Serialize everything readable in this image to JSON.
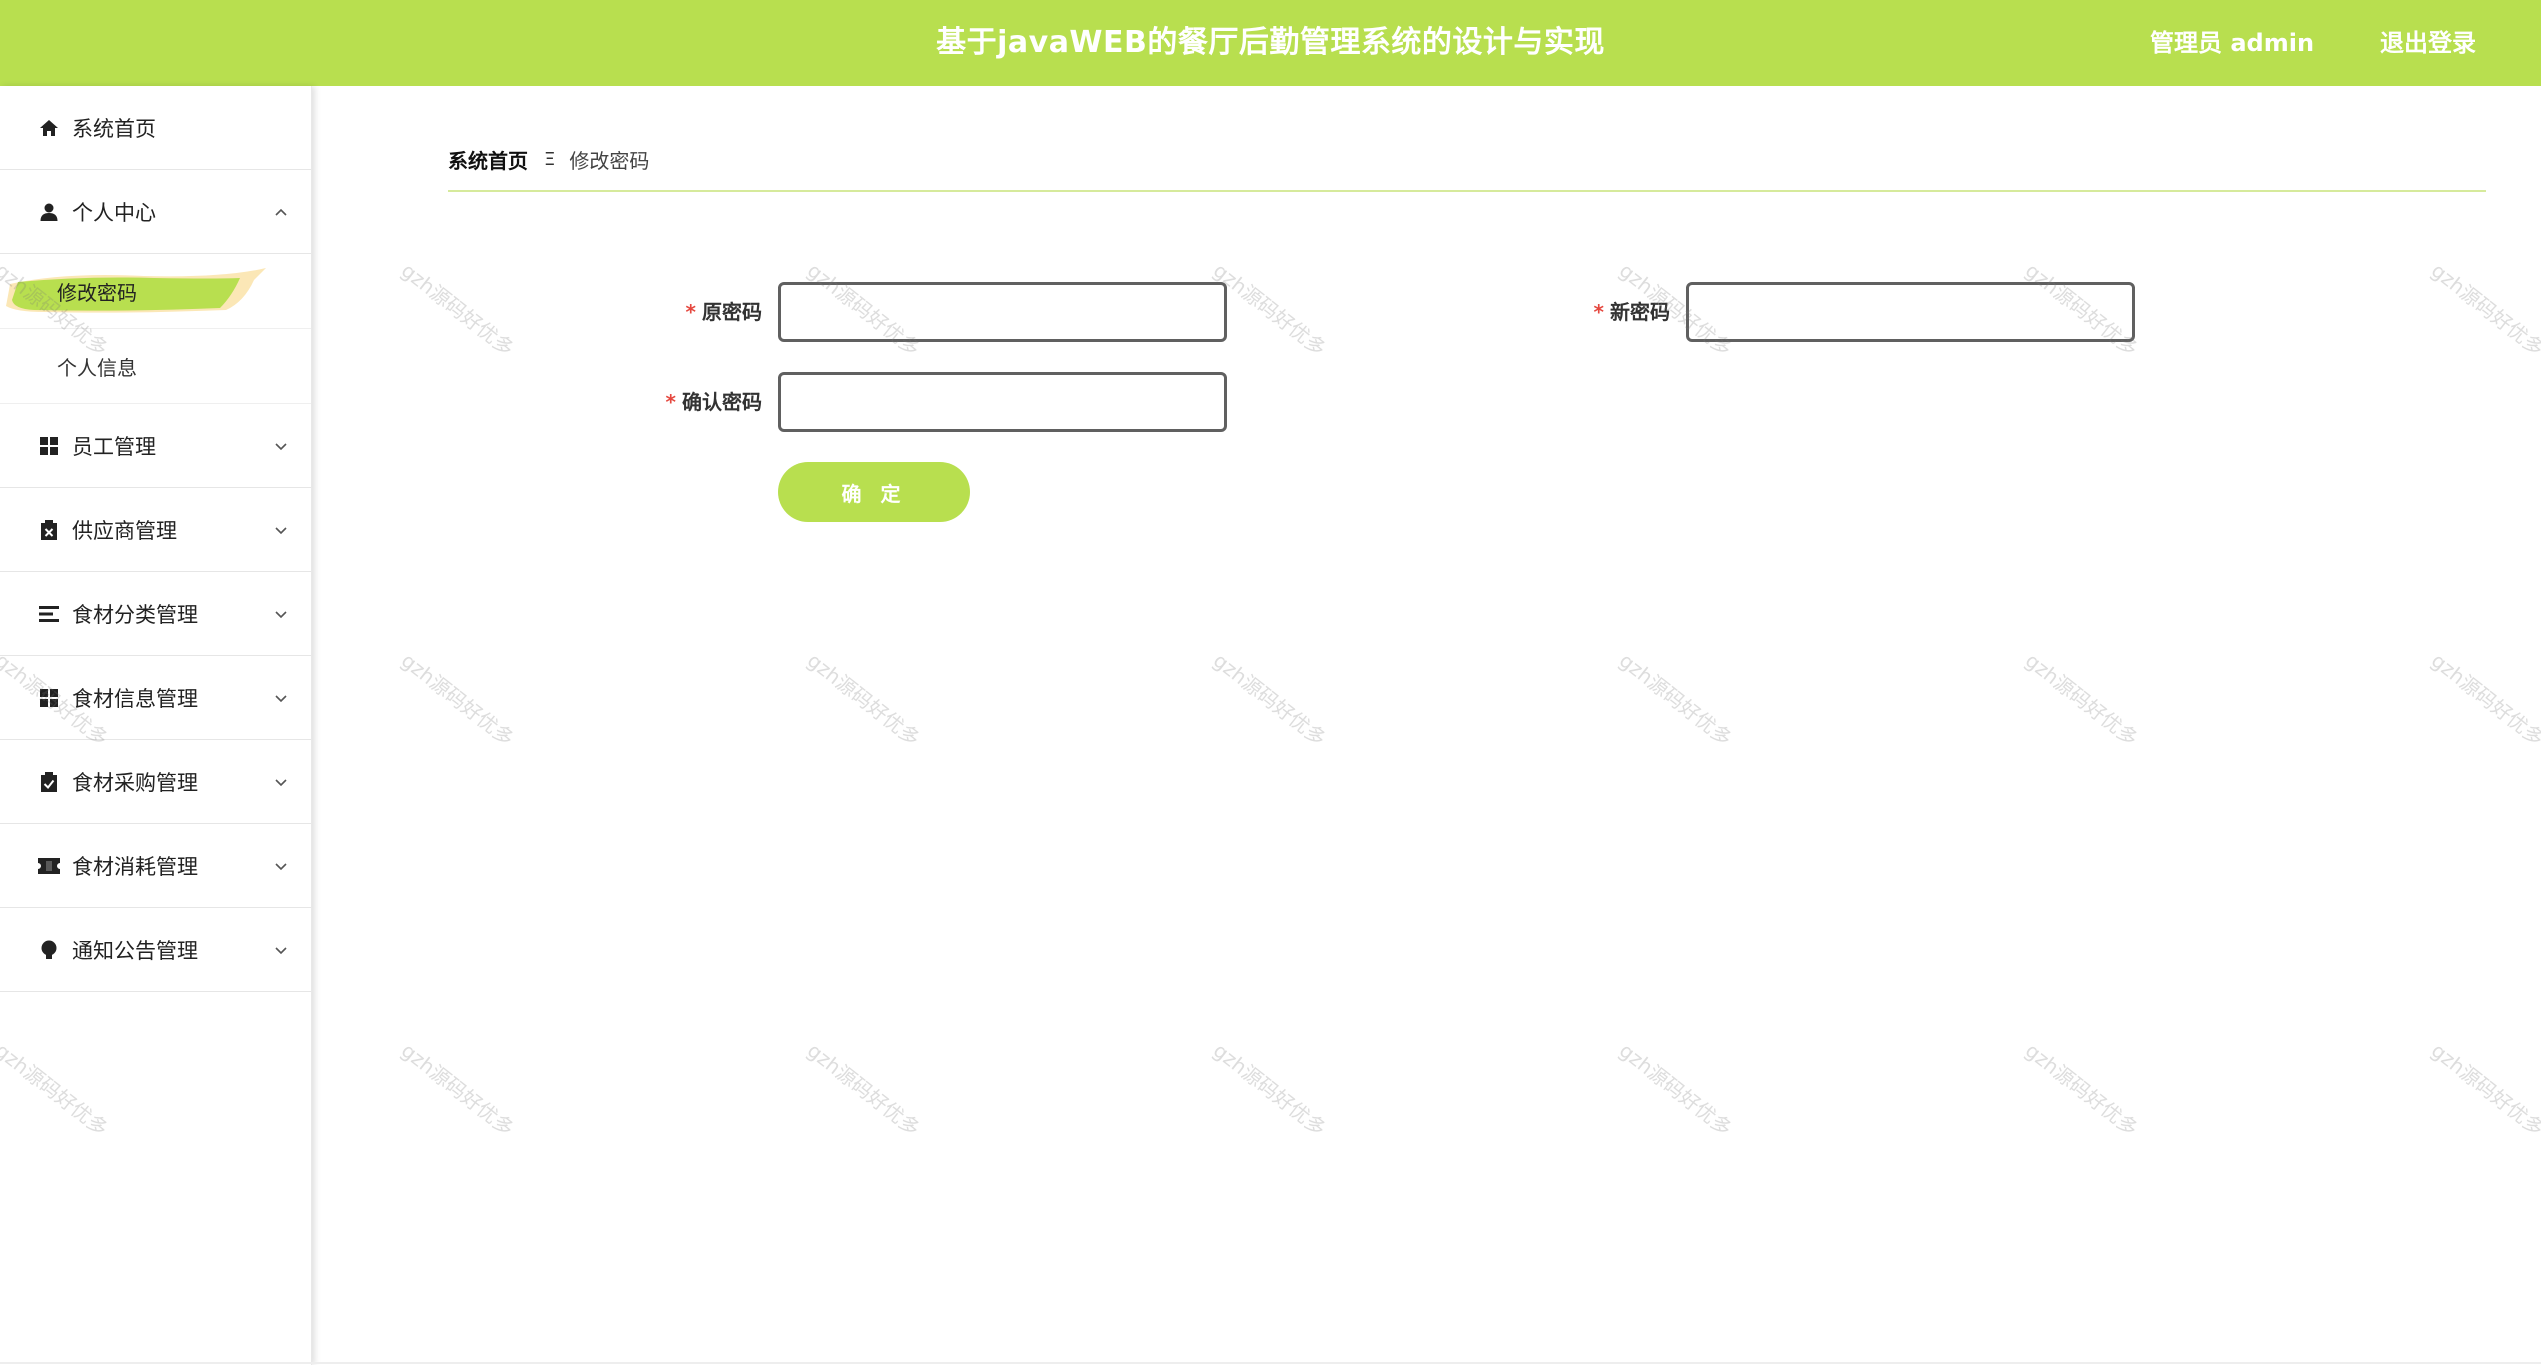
{
  "header": {
    "title": "基于javaWEB的餐厅后勤管理系统的设计与实现",
    "user_label": "管理员 admin",
    "logout_label": "退出登录"
  },
  "sidebar": {
    "items": [
      {
        "label": "系统首页",
        "icon": "home-icon"
      },
      {
        "label": "个人中心",
        "icon": "user-icon",
        "expanded": true,
        "children": [
          {
            "label": "修改密码",
            "active": true
          },
          {
            "label": "个人信息"
          }
        ]
      },
      {
        "label": "员工管理",
        "icon": "grid-icon"
      },
      {
        "label": "供应商管理",
        "icon": "clipboard-x-icon"
      },
      {
        "label": "食材分类管理",
        "icon": "list-icon"
      },
      {
        "label": "食材信息管理",
        "icon": "grid-icon"
      },
      {
        "label": "食材采购管理",
        "icon": "clipboard-check-icon"
      },
      {
        "label": "食材消耗管理",
        "icon": "ticket-icon"
      },
      {
        "label": "通知公告管理",
        "icon": "bulb-icon"
      }
    ]
  },
  "breadcrumb": {
    "home": "系统首页",
    "separator": "Ξ",
    "current": "修改密码"
  },
  "form": {
    "old_password_label": "原密码",
    "new_password_label": "新密码",
    "confirm_password_label": "确认密码",
    "required_mark": "*",
    "old_password_value": "",
    "new_password_value": "",
    "confirm_password_value": "",
    "submit_label": "确 定"
  },
  "watermark": "gzh源码好优多",
  "colors": {
    "accent": "#b8df4f",
    "required": "#e5483f"
  }
}
